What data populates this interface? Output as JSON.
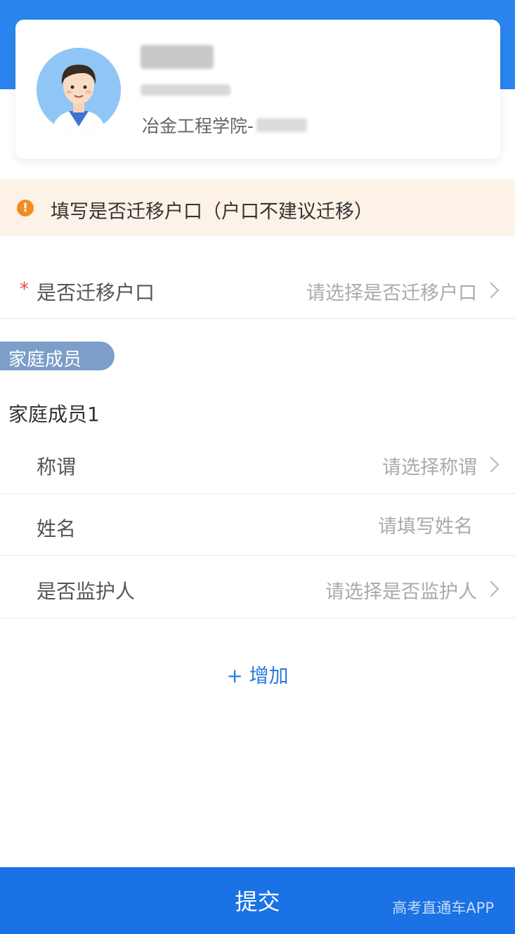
{
  "profile": {
    "college": "冶金工程学院-"
  },
  "notice": {
    "icon": "exclamation-icon",
    "text": "填写是否迁移户口（户口不建议迁移）"
  },
  "migrate_field": {
    "required_mark": "*",
    "label": "是否迁移户口",
    "placeholder": "请选择是否迁移户口"
  },
  "family": {
    "section_title": "家庭成员",
    "member_title": "家庭成员1",
    "fields": {
      "relation": {
        "label": "称谓",
        "placeholder": "请选择称谓"
      },
      "name": {
        "label": "姓名",
        "placeholder": "请填写姓名"
      },
      "guardian": {
        "label": "是否监护人",
        "placeholder": "请选择是否监护人"
      }
    },
    "add_label": "+ 增加"
  },
  "footer": {
    "submit_label": "提交",
    "watermark": "高考直通车APP"
  },
  "colors": {
    "primary": "#2a86ee",
    "notice_bg": "#fdf2e7",
    "notice_icon": "#f08c24",
    "required": "#ee4040",
    "section_pill": "#7c9ec8",
    "submit_bar": "#1a72e4"
  }
}
